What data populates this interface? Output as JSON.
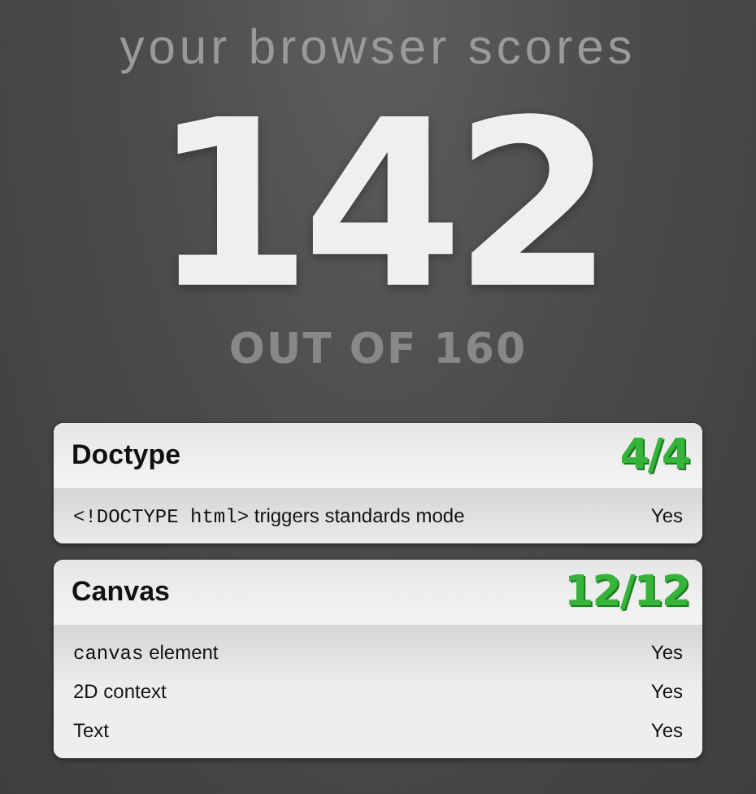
{
  "heading": "your browser scores",
  "score": "142",
  "out_of": "OUT OF 160",
  "sections": [
    {
      "title": "Doctype",
      "score": "4/4",
      "items": [
        {
          "code": "<!DOCTYPE html>",
          "text": "triggers standards mode",
          "result": "Yes"
        }
      ]
    },
    {
      "title": "Canvas",
      "score": "12/12",
      "items": [
        {
          "code": "canvas",
          "text": "element",
          "result": "Yes"
        },
        {
          "text": "2D context",
          "result": "Yes"
        },
        {
          "text": "Text",
          "result": "Yes"
        }
      ]
    }
  ]
}
